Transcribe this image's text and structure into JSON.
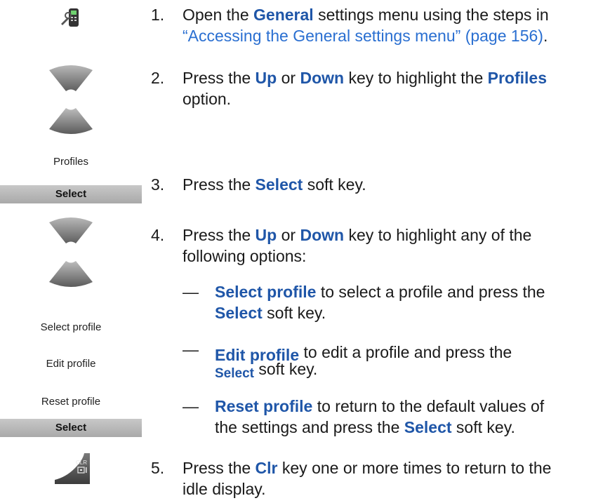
{
  "icons": {
    "settings_icon": "settings-phone-icon",
    "nav_up": "nav-up-key-icon",
    "nav_down": "nav-down-key-icon",
    "clr_key": "clr-key-icon",
    "clr_key_label": "CLR"
  },
  "left_column": {
    "profiles_label": "Profiles",
    "select_softkey_1": "Select",
    "select_profile_label": "Select profile",
    "edit_profile_label": "Edit profile",
    "reset_profile_label": "Reset profile",
    "select_softkey_2": "Select"
  },
  "steps": [
    {
      "number": "1.",
      "t1": "Open the ",
      "b1": "General",
      "t2": " settings menu using the steps in",
      "link": "“Accessing the General settings menu” (page 156)",
      "t3": "."
    },
    {
      "number": "2.",
      "t1": "Press the ",
      "b1": "Up",
      "t2": " or ",
      "b2": "Down",
      "t3": " key to highlight the ",
      "b3": "Profiles",
      "t4": "option."
    },
    {
      "number": "3.",
      "t1": "Press the ",
      "b1": "Select",
      "t2": " soft key."
    },
    {
      "number": "4.",
      "t1": "Press the ",
      "b1": "Up",
      "t2": " or ",
      "b2": "Down",
      "t3": " key to highlight any of the",
      "t4": "following options:"
    },
    {
      "number": "5.",
      "t1": "Press the ",
      "b1": "Clr",
      "t2": " key one or more times to return to the",
      "t3": "idle display."
    }
  ],
  "sub_options": [
    {
      "dash": "—",
      "b1": "Select profile",
      "t1": " to select a profile and press the",
      "b2": "Select",
      "t2": " soft key."
    },
    {
      "dash": "—",
      "b1": "Edit profile",
      "t1": " to edit a profile and press the",
      "b2": "Select",
      "t2": " soft key."
    },
    {
      "dash": "—",
      "b1": "Reset profile",
      "t1": " to return to the default values of",
      "t2": "the settings and press the ",
      "b2": "Select",
      "t3": " soft key."
    }
  ],
  "colors": {
    "accent": "#1f56a8",
    "link": "#2a6fd1",
    "softkey": "#b5b5b5",
    "nav_key": "#8a8a8a"
  }
}
